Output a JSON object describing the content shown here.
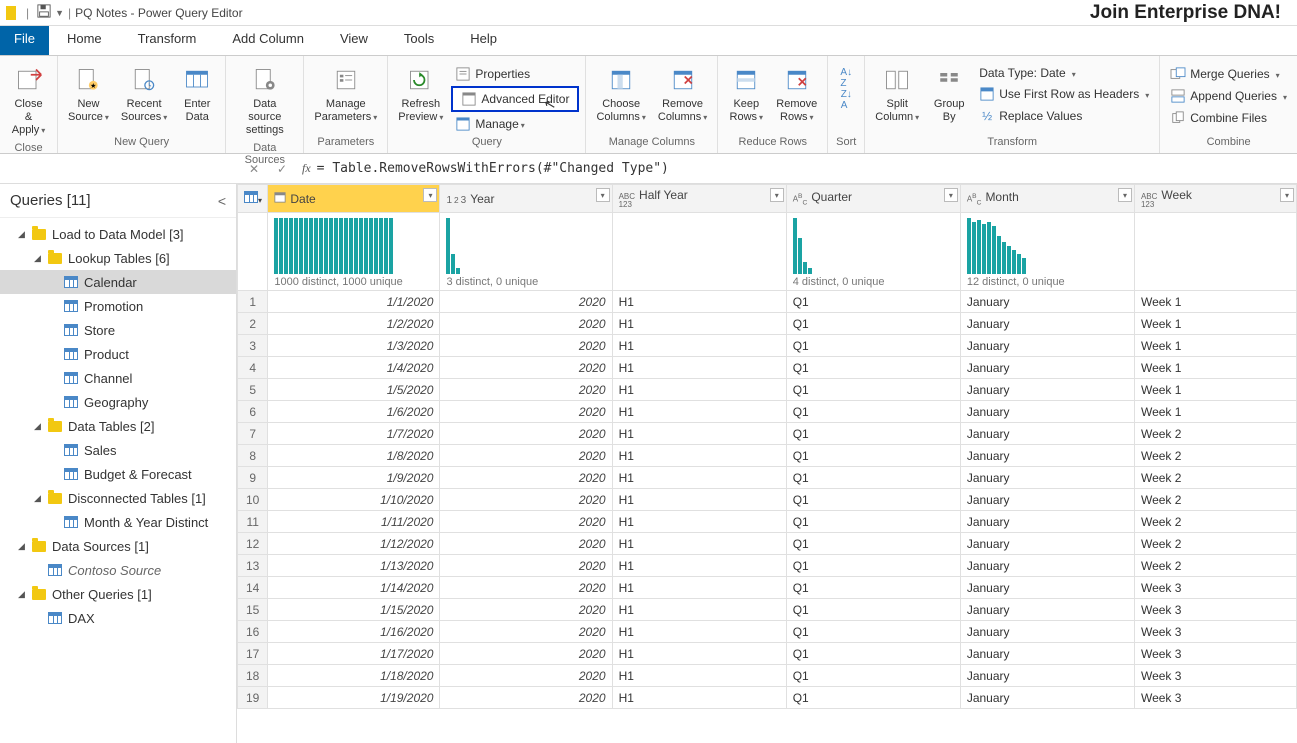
{
  "titlebar": {
    "title": "PQ Notes - Power Query Editor"
  },
  "cta": "Join Enterprise DNA!",
  "menu": {
    "file": "File",
    "home": "Home",
    "transform": "Transform",
    "addcol": "Add Column",
    "view": "View",
    "tools": "Tools",
    "help": "Help"
  },
  "ribbon": {
    "close": {
      "label": "Close &\nApply",
      "group": "Close"
    },
    "newquery": {
      "newsource": "New\nSource",
      "recent": "Recent\nSources",
      "enter": "Enter\nData",
      "group": "New Query"
    },
    "datasources": {
      "settings": "Data source\nsettings",
      "group": "Data Sources"
    },
    "params": {
      "manage": "Manage\nParameters",
      "group": "Parameters"
    },
    "query": {
      "refresh": "Refresh\nPreview",
      "properties": "Properties",
      "advanced": "Advanced Editor",
      "manage": "Manage",
      "group": "Query"
    },
    "managecols": {
      "choose": "Choose\nColumns",
      "remove": "Remove\nColumns",
      "group": "Manage Columns"
    },
    "reducerows": {
      "keep": "Keep\nRows",
      "remove": "Remove\nRows",
      "group": "Reduce Rows"
    },
    "sort": {
      "group": "Sort"
    },
    "transform": {
      "split": "Split\nColumn",
      "group": "Group\nBy",
      "datatype": "Data Type: Date",
      "firstrow": "Use First Row as Headers",
      "replace": "Replace Values",
      "label": "Transform"
    },
    "combine": {
      "merge": "Merge Queries",
      "append": "Append Queries",
      "combinefiles": "Combine Files",
      "group": "Combine"
    }
  },
  "formula": "= Table.RemoveRowsWithErrors(#\"Changed Type\")",
  "sidebar": {
    "title": "Queries [11]",
    "groups": [
      {
        "label": "Load to Data Model [3]",
        "type": "folder",
        "level": 1
      },
      {
        "label": "Lookup Tables [6]",
        "type": "folder",
        "level": 2
      },
      {
        "label": "Calendar",
        "type": "table",
        "level": 3,
        "selected": true
      },
      {
        "label": "Promotion",
        "type": "table",
        "level": 3
      },
      {
        "label": "Store",
        "type": "table",
        "level": 3
      },
      {
        "label": "Product",
        "type": "table",
        "level": 3
      },
      {
        "label": "Channel",
        "type": "table",
        "level": 3
      },
      {
        "label": "Geography",
        "type": "table",
        "level": 3
      },
      {
        "label": "Data Tables [2]",
        "type": "folder",
        "level": 2
      },
      {
        "label": "Sales",
        "type": "table",
        "level": 3
      },
      {
        "label": "Budget & Forecast",
        "type": "table",
        "level": 3
      },
      {
        "label": "Disconnected Tables [1]",
        "type": "folder",
        "level": 2
      },
      {
        "label": "Month & Year Distinct",
        "type": "table",
        "level": 3
      },
      {
        "label": "Data Sources [1]",
        "type": "folder",
        "level": 1
      },
      {
        "label": "Contoso Source",
        "type": "table",
        "level": 2,
        "italic": true
      },
      {
        "label": "Other Queries [1]",
        "type": "folder",
        "level": 1
      },
      {
        "label": "DAX",
        "type": "table",
        "level": 2
      }
    ]
  },
  "columns": [
    {
      "name": "Date",
      "type": "date",
      "profile": "1000 distinct, 1000 unique",
      "bars": 24
    },
    {
      "name": "Year",
      "type": "123",
      "profile": "3 distinct, 0 unique",
      "bars": 3
    },
    {
      "name": "Half Year",
      "type": "ABC123",
      "profile": "",
      "bars": 0
    },
    {
      "name": "Quarter",
      "type": "ABC",
      "profile": "4 distinct, 0 unique",
      "bars": 4
    },
    {
      "name": "Month",
      "type": "ABC",
      "profile": "12 distinct, 0 unique",
      "bars": 12
    },
    {
      "name": "Week",
      "type": "ABC123",
      "profile": "",
      "bars": 0
    }
  ],
  "rows": [
    {
      "n": 1,
      "date": "1/1/2020",
      "year": "2020",
      "half": "H1",
      "q": "Q1",
      "month": "January",
      "week": "Week 1"
    },
    {
      "n": 2,
      "date": "1/2/2020",
      "year": "2020",
      "half": "H1",
      "q": "Q1",
      "month": "January",
      "week": "Week 1"
    },
    {
      "n": 3,
      "date": "1/3/2020",
      "year": "2020",
      "half": "H1",
      "q": "Q1",
      "month": "January",
      "week": "Week 1"
    },
    {
      "n": 4,
      "date": "1/4/2020",
      "year": "2020",
      "half": "H1",
      "q": "Q1",
      "month": "January",
      "week": "Week 1"
    },
    {
      "n": 5,
      "date": "1/5/2020",
      "year": "2020",
      "half": "H1",
      "q": "Q1",
      "month": "January",
      "week": "Week 1"
    },
    {
      "n": 6,
      "date": "1/6/2020",
      "year": "2020",
      "half": "H1",
      "q": "Q1",
      "month": "January",
      "week": "Week 1"
    },
    {
      "n": 7,
      "date": "1/7/2020",
      "year": "2020",
      "half": "H1",
      "q": "Q1",
      "month": "January",
      "week": "Week 2"
    },
    {
      "n": 8,
      "date": "1/8/2020",
      "year": "2020",
      "half": "H1",
      "q": "Q1",
      "month": "January",
      "week": "Week 2"
    },
    {
      "n": 9,
      "date": "1/9/2020",
      "year": "2020",
      "half": "H1",
      "q": "Q1",
      "month": "January",
      "week": "Week 2"
    },
    {
      "n": 10,
      "date": "1/10/2020",
      "year": "2020",
      "half": "H1",
      "q": "Q1",
      "month": "January",
      "week": "Week 2"
    },
    {
      "n": 11,
      "date": "1/11/2020",
      "year": "2020",
      "half": "H1",
      "q": "Q1",
      "month": "January",
      "week": "Week 2"
    },
    {
      "n": 12,
      "date": "1/12/2020",
      "year": "2020",
      "half": "H1",
      "q": "Q1",
      "month": "January",
      "week": "Week 2"
    },
    {
      "n": 13,
      "date": "1/13/2020",
      "year": "2020",
      "half": "H1",
      "q": "Q1",
      "month": "January",
      "week": "Week 2"
    },
    {
      "n": 14,
      "date": "1/14/2020",
      "year": "2020",
      "half": "H1",
      "q": "Q1",
      "month": "January",
      "week": "Week 3"
    },
    {
      "n": 15,
      "date": "1/15/2020",
      "year": "2020",
      "half": "H1",
      "q": "Q1",
      "month": "January",
      "week": "Week 3"
    },
    {
      "n": 16,
      "date": "1/16/2020",
      "year": "2020",
      "half": "H1",
      "q": "Q1",
      "month": "January",
      "week": "Week 3"
    },
    {
      "n": 17,
      "date": "1/17/2020",
      "year": "2020",
      "half": "H1",
      "q": "Q1",
      "month": "January",
      "week": "Week 3"
    },
    {
      "n": 18,
      "date": "1/18/2020",
      "year": "2020",
      "half": "H1",
      "q": "Q1",
      "month": "January",
      "week": "Week 3"
    },
    {
      "n": 19,
      "date": "1/19/2020",
      "year": "2020",
      "half": "H1",
      "q": "Q1",
      "month": "January",
      "week": "Week 3"
    }
  ]
}
